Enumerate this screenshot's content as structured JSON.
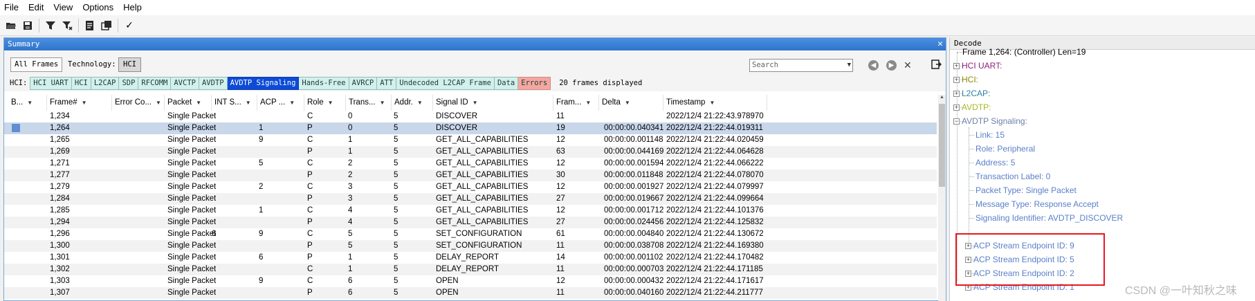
{
  "menu": {
    "file": "File",
    "edit": "Edit",
    "view": "View",
    "options": "Options",
    "help": "Help"
  },
  "toolbar": {
    "check_label": "✓"
  },
  "summary": {
    "title": "Summary",
    "all_frames": "All Frames",
    "technology_label": "Technology:",
    "technology_value": "HCI",
    "search_placeholder": "Search",
    "hci_label": "HCI:",
    "protocol_tabs": [
      "HCI UART",
      "HCI",
      "L2CAP",
      "SDP",
      "RFCOMM",
      "AVCTP",
      "AVDTP",
      "AVDTP Signaling",
      "Hands-Free",
      "AVRCP",
      "ATT",
      "Undecoded L2CAP Frame",
      "Data",
      "Errors"
    ],
    "active_tab": "AVDTP Signaling",
    "frames_displayed": "20 frames displayed",
    "columns": [
      "B...",
      "Frame#",
      "Error Co...",
      "Packet",
      "INT S...",
      "ACP ...",
      "Role",
      "Trans...",
      "Addr.",
      "Signal ID",
      "Fram...",
      "Delta",
      "Timestamp"
    ],
    "rows": [
      {
        "frame": "1,234",
        "error": "",
        "packet": "Single Packet",
        "int": "",
        "acp": "",
        "role": "C",
        "trans": "0",
        "addr": "5",
        "signal": "DISCOVER",
        "len": "11",
        "delta": "",
        "ts": "2022/12/4 21:22:43.978970",
        "bookmark": false,
        "selected": false
      },
      {
        "frame": "1,264",
        "error": "",
        "packet": "Single Packet",
        "int": "",
        "acp": "1",
        "role": "P",
        "trans": "0",
        "addr": "5",
        "signal": "DISCOVER",
        "len": "19",
        "delta": "00:00:00.040341",
        "ts": "2022/12/4 21:22:44.019311",
        "bookmark": true,
        "selected": true
      },
      {
        "frame": "1,265",
        "error": "",
        "packet": "Single Packet",
        "int": "",
        "acp": "9",
        "role": "C",
        "trans": "1",
        "addr": "5",
        "signal": "GET_ALL_CAPABILITIES",
        "len": "12",
        "delta": "00:00:00.001148",
        "ts": "2022/12/4 21:22:44.020459",
        "bookmark": false,
        "selected": false
      },
      {
        "frame": "1,269",
        "error": "",
        "packet": "Single Packet",
        "int": "",
        "acp": "",
        "role": "P",
        "trans": "1",
        "addr": "5",
        "signal": "GET_ALL_CAPABILITIES",
        "len": "63",
        "delta": "00:00:00.044169",
        "ts": "2022/12/4 21:22:44.064628",
        "bookmark": false,
        "selected": false
      },
      {
        "frame": "1,271",
        "error": "",
        "packet": "Single Packet",
        "int": "",
        "acp": "5",
        "role": "C",
        "trans": "2",
        "addr": "5",
        "signal": "GET_ALL_CAPABILITIES",
        "len": "12",
        "delta": "00:00:00.001594",
        "ts": "2022/12/4 21:22:44.066222",
        "bookmark": false,
        "selected": false
      },
      {
        "frame": "1,277",
        "error": "",
        "packet": "Single Packet",
        "int": "",
        "acp": "",
        "role": "P",
        "trans": "2",
        "addr": "5",
        "signal": "GET_ALL_CAPABILITIES",
        "len": "30",
        "delta": "00:00:00.011848",
        "ts": "2022/12/4 21:22:44.078070",
        "bookmark": false,
        "selected": false
      },
      {
        "frame": "1,279",
        "error": "",
        "packet": "Single Packet",
        "int": "",
        "acp": "2",
        "role": "C",
        "trans": "3",
        "addr": "5",
        "signal": "GET_ALL_CAPABILITIES",
        "len": "12",
        "delta": "00:00:00.001927",
        "ts": "2022/12/4 21:22:44.079997",
        "bookmark": false,
        "selected": false
      },
      {
        "frame": "1,284",
        "error": "",
        "packet": "Single Packet",
        "int": "",
        "acp": "",
        "role": "P",
        "trans": "3",
        "addr": "5",
        "signal": "GET_ALL_CAPABILITIES",
        "len": "27",
        "delta": "00:00:00.019667",
        "ts": "2022/12/4 21:22:44.099664",
        "bookmark": false,
        "selected": false
      },
      {
        "frame": "1,285",
        "error": "",
        "packet": "Single Packet",
        "int": "",
        "acp": "1",
        "role": "C",
        "trans": "4",
        "addr": "5",
        "signal": "GET_ALL_CAPABILITIES",
        "len": "12",
        "delta": "00:00:00.001712",
        "ts": "2022/12/4 21:22:44.101376",
        "bookmark": false,
        "selected": false
      },
      {
        "frame": "1,294",
        "error": "",
        "packet": "Single Packet",
        "int": "",
        "acp": "",
        "role": "P",
        "trans": "4",
        "addr": "5",
        "signal": "GET_ALL_CAPABILITIES",
        "len": "27",
        "delta": "00:00:00.024456",
        "ts": "2022/12/4 21:22:44.125832",
        "bookmark": false,
        "selected": false
      },
      {
        "frame": "1,296",
        "error": "",
        "packet": "Single Packet",
        "int": "6",
        "acp": "9",
        "role": "C",
        "trans": "5",
        "addr": "5",
        "signal": "SET_CONFIGURATION",
        "len": "61",
        "delta": "00:00:00.004840",
        "ts": "2022/12/4 21:22:44.130672",
        "bookmark": false,
        "selected": false
      },
      {
        "frame": "1,300",
        "error": "",
        "packet": "Single Packet",
        "int": "",
        "acp": "",
        "role": "P",
        "trans": "5",
        "addr": "5",
        "signal": "SET_CONFIGURATION",
        "len": "11",
        "delta": "00:00:00.038708",
        "ts": "2022/12/4 21:22:44.169380",
        "bookmark": false,
        "selected": false
      },
      {
        "frame": "1,301",
        "error": "",
        "packet": "Single Packet",
        "int": "",
        "acp": "6",
        "role": "P",
        "trans": "1",
        "addr": "5",
        "signal": "DELAY_REPORT",
        "len": "14",
        "delta": "00:00:00.001102",
        "ts": "2022/12/4 21:22:44.170482",
        "bookmark": false,
        "selected": false
      },
      {
        "frame": "1,302",
        "error": "",
        "packet": "Single Packet",
        "int": "",
        "acp": "",
        "role": "C",
        "trans": "1",
        "addr": "5",
        "signal": "DELAY_REPORT",
        "len": "11",
        "delta": "00:00:00.000703",
        "ts": "2022/12/4 21:22:44.171185",
        "bookmark": false,
        "selected": false
      },
      {
        "frame": "1,303",
        "error": "",
        "packet": "Single Packet",
        "int": "",
        "acp": "9",
        "role": "C",
        "trans": "6",
        "addr": "5",
        "signal": "OPEN",
        "len": "12",
        "delta": "00:00:00.000432",
        "ts": "2022/12/4 21:22:44.171617",
        "bookmark": false,
        "selected": false
      },
      {
        "frame": "1,307",
        "error": "",
        "packet": "Single Packet",
        "int": "",
        "acp": "",
        "role": "P",
        "trans": "6",
        "addr": "5",
        "signal": "OPEN",
        "len": "11",
        "delta": "00:00:00.040160",
        "ts": "2022/12/4 21:22:44.211777",
        "bookmark": false,
        "selected": false
      }
    ]
  },
  "decode": {
    "title": "Decode",
    "frame_line": "Frame 1,264: (Controller) Len=19",
    "nodes": [
      {
        "label": "HCI UART:",
        "color": "#8e1e7a"
      },
      {
        "label": "HCI:",
        "color": "#8a8a00"
      },
      {
        "label": "L2CAP:",
        "color": "#2d7fa3"
      },
      {
        "label": "AVDTP:",
        "color": "#a8b820"
      },
      {
        "label": "AVDTP Signaling:",
        "color": "#6b7fa8"
      }
    ],
    "fields": [
      "Link: 15",
      "Role: Peripheral",
      "Address: 5",
      "Transaction Label: 0",
      "Packet Type: Single Packet",
      "Message Type: Response Accept",
      "Signaling Identifier: AVDTP_DISCOVER"
    ],
    "field_color": "#5a7fc8",
    "acp_endpoints": [
      "ACP Stream Endpoint ID: 9",
      "ACP Stream Endpoint ID: 5",
      "ACP Stream Endpoint ID: 2",
      "ACP Stream Endpoint ID: 1"
    ]
  },
  "watermark": "CSDN @一叶知秋之味"
}
